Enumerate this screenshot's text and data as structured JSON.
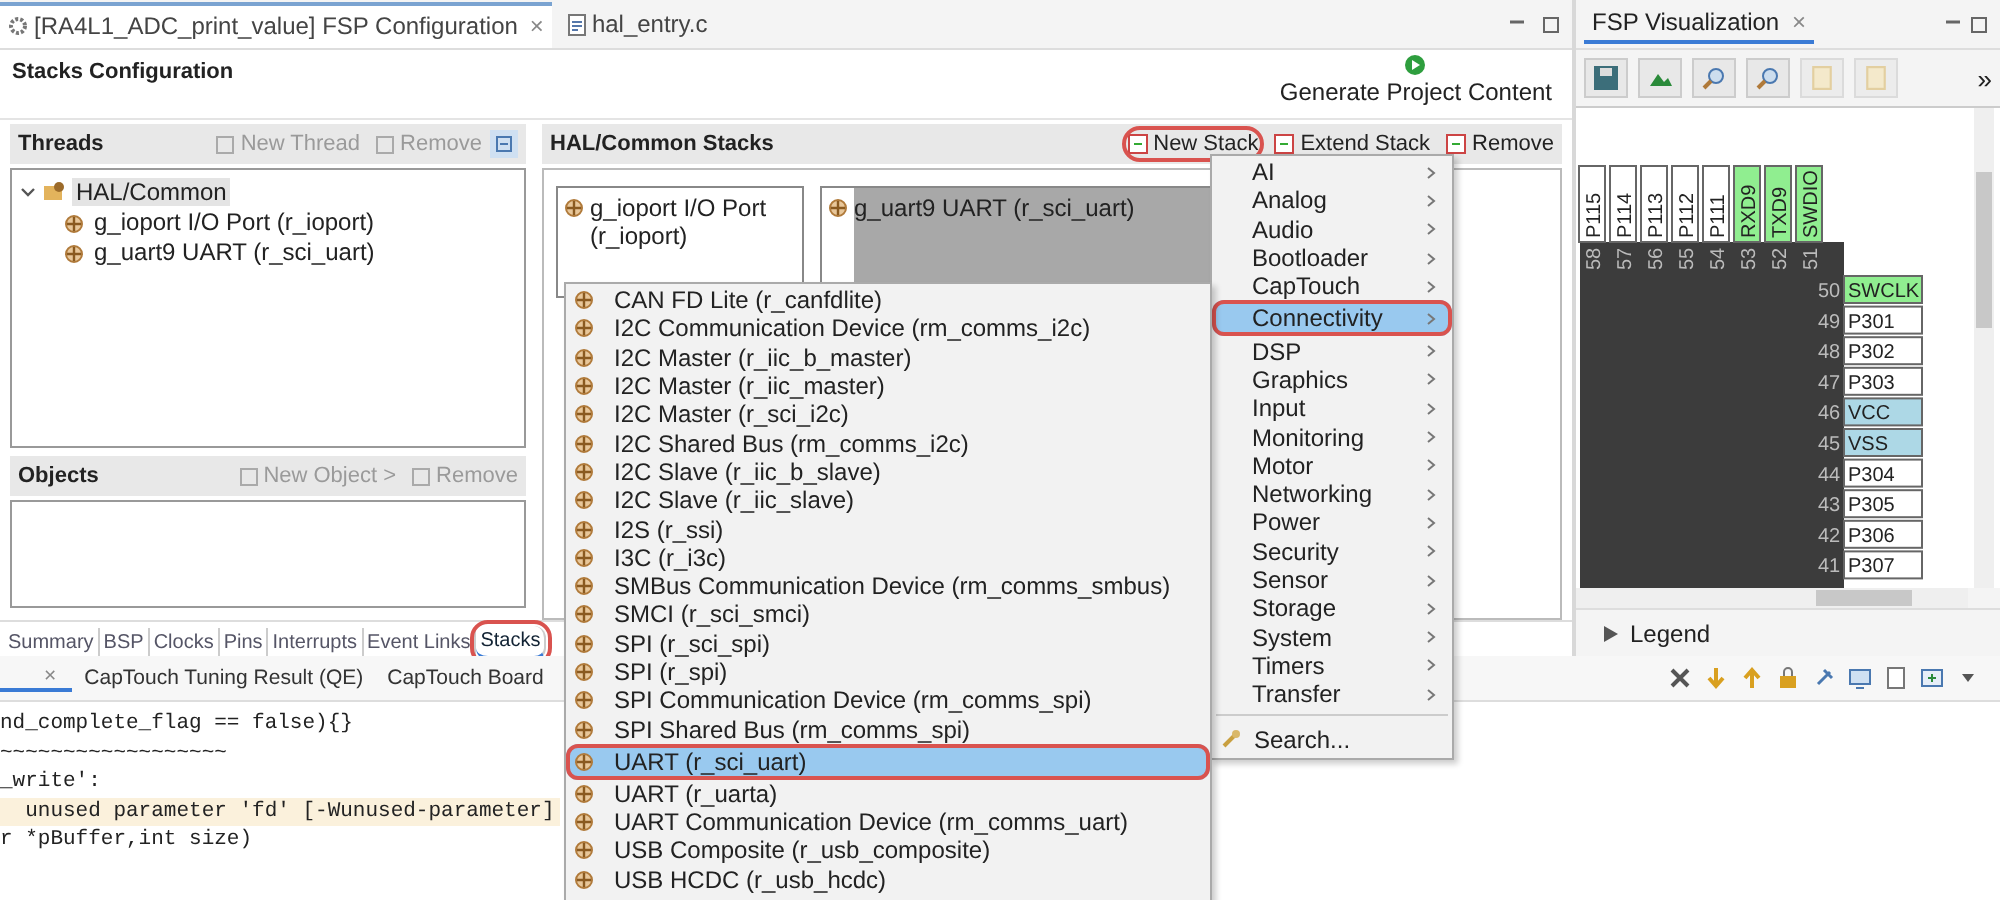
{
  "editor_tabs": [
    {
      "label": "[RA4L1_ADC_print_value] FSP Configuration",
      "selected": true,
      "close": "×"
    },
    {
      "label": "hal_entry.c",
      "selected": false
    }
  ],
  "header": {
    "title": "Stacks Configuration",
    "generate": "Generate Project Content"
  },
  "threads": {
    "title": "Threads",
    "actions": [
      "New Thread",
      "Remove"
    ],
    "tree": [
      {
        "label": "HAL/Common",
        "selected": true,
        "expanded": true,
        "children": [
          {
            "label": "g_ioport I/O Port (r_ioport)",
            "selected": false
          },
          {
            "label": "g_uart9 UART (r_sci_uart)",
            "selected": false
          }
        ]
      }
    ]
  },
  "objects": {
    "title": "Objects",
    "actions": [
      "New Object >",
      "Remove"
    ]
  },
  "stacks": {
    "title": "HAL/Common Stacks",
    "actions": [
      {
        "label": "New Stack",
        "highlighted": true
      },
      {
        "label": "Extend Stack",
        "highlighted": false
      },
      {
        "label": "Remove",
        "highlighted": false
      }
    ],
    "modules": [
      {
        "label": "g_ioport I/O Port (r_ioport)",
        "selected": false
      },
      {
        "label": "g_uart9 UART (r_sci_uart)",
        "selected": true
      }
    ]
  },
  "config_tabs": [
    {
      "label": "Summary",
      "selected": false,
      "highlighted": false
    },
    {
      "label": "BSP",
      "selected": false,
      "highlighted": false
    },
    {
      "label": "Clocks",
      "selected": false,
      "highlighted": false
    },
    {
      "label": "Pins",
      "selected": false,
      "highlighted": false
    },
    {
      "label": "Interrupts",
      "selected": false,
      "highlighted": false
    },
    {
      "label": "Event Links",
      "selected": false,
      "highlighted": false
    },
    {
      "label": "Stacks",
      "selected": true,
      "highlighted": true
    }
  ],
  "console": {
    "close": "×",
    "tabs": [
      "CapTouch Tuning Result (QE)",
      "CapTouch Board"
    ],
    "lines": [
      {
        "text": "nd_complete_flag == false){}",
        "highlighted": false
      },
      {
        "text": "~~~~~~~~~~~~~~~~~~",
        "highlighted": false
      },
      {
        "text": "_write':",
        "highlighted": false
      },
      {
        "text": "  unused parameter 'fd' [-Wunused-parameter]",
        "highlighted": true
      },
      {
        "text": "r *pBuffer,int size)",
        "highlighted": false
      }
    ]
  },
  "visualization": {
    "title": "FSP Visualization",
    "close": "×",
    "more": "»",
    "legend": "Legend",
    "top_pins": [
      {
        "name": "P115",
        "number": "58",
        "color": "#ffffff"
      },
      {
        "name": "P114",
        "number": "57",
        "color": "#ffffff"
      },
      {
        "name": "P113",
        "number": "56",
        "color": "#ffffff"
      },
      {
        "name": "P112",
        "number": "55",
        "color": "#ffffff"
      },
      {
        "name": "P111",
        "number": "54",
        "color": "#ffffff"
      },
      {
        "name": "RXD9",
        "number": "53",
        "color": "#90ee90"
      },
      {
        "name": "TXD9",
        "number": "52",
        "color": "#90ee90"
      },
      {
        "name": "SWDIO",
        "number": "51",
        "color": "#90ee90"
      }
    ],
    "right_pins": [
      {
        "name": "SWCLK",
        "number": "50",
        "color": "#90ee90"
      },
      {
        "name": "P301",
        "number": "49",
        "color": "#ffffff"
      },
      {
        "name": "P302",
        "number": "48",
        "color": "#ffffff"
      },
      {
        "name": "P303",
        "number": "47",
        "color": "#ffffff"
      },
      {
        "name": "VCC",
        "number": "46",
        "color": "#add8e6"
      },
      {
        "name": "VSS",
        "number": "45",
        "color": "#add8e6"
      },
      {
        "name": "P304",
        "number": "44",
        "color": "#ffffff"
      },
      {
        "name": "P305",
        "number": "43",
        "color": "#ffffff"
      },
      {
        "name": "P306",
        "number": "42",
        "color": "#ffffff"
      },
      {
        "name": "P307",
        "number": "41",
        "color": "#ffffff"
      }
    ]
  },
  "category_menu": {
    "search": "Search...",
    "items": [
      {
        "label": "AI",
        "selected": false,
        "highlighted": false
      },
      {
        "label": "Analog",
        "selected": false,
        "highlighted": false
      },
      {
        "label": "Audio",
        "selected": false,
        "highlighted": false
      },
      {
        "label": "Bootloader",
        "selected": false,
        "highlighted": false
      },
      {
        "label": "CapTouch",
        "selected": false,
        "highlighted": false
      },
      {
        "label": "Connectivity",
        "selected": true,
        "highlighted": true
      },
      {
        "label": "DSP",
        "selected": false,
        "highlighted": false
      },
      {
        "label": "Graphics",
        "selected": false,
        "highlighted": false
      },
      {
        "label": "Input",
        "selected": false,
        "highlighted": false
      },
      {
        "label": "Monitoring",
        "selected": false,
        "highlighted": false
      },
      {
        "label": "Motor",
        "selected": false,
        "highlighted": false
      },
      {
        "label": "Networking",
        "selected": false,
        "highlighted": false
      },
      {
        "label": "Power",
        "selected": false,
        "highlighted": false
      },
      {
        "label": "Security",
        "selected": false,
        "highlighted": false
      },
      {
        "label": "Sensor",
        "selected": false,
        "highlighted": false
      },
      {
        "label": "Storage",
        "selected": false,
        "highlighted": false
      },
      {
        "label": "System",
        "selected": false,
        "highlighted": false
      },
      {
        "label": "Timers",
        "selected": false,
        "highlighted": false
      },
      {
        "label": "Transfer",
        "selected": false,
        "highlighted": false
      }
    ]
  },
  "module_menu": {
    "items": [
      {
        "label": "CAN FD Lite (r_canfdlite)",
        "selected": false,
        "highlighted": false
      },
      {
        "label": "I2C Communication Device (rm_comms_i2c)",
        "selected": false,
        "highlighted": false
      },
      {
        "label": "I2C Master (r_iic_b_master)",
        "selected": false,
        "highlighted": false
      },
      {
        "label": "I2C Master (r_iic_master)",
        "selected": false,
        "highlighted": false
      },
      {
        "label": "I2C Master (r_sci_i2c)",
        "selected": false,
        "highlighted": false
      },
      {
        "label": "I2C Shared Bus (rm_comms_i2c)",
        "selected": false,
        "highlighted": false
      },
      {
        "label": "I2C Slave (r_iic_b_slave)",
        "selected": false,
        "highlighted": false
      },
      {
        "label": "I2C Slave (r_iic_slave)",
        "selected": false,
        "highlighted": false
      },
      {
        "label": "I2S (r_ssi)",
        "selected": false,
        "highlighted": false
      },
      {
        "label": "I3C (r_i3c)",
        "selected": false,
        "highlighted": false
      },
      {
        "label": "SMBus Communication Device (rm_comms_smbus)",
        "selected": false,
        "highlighted": false
      },
      {
        "label": "SMCI (r_sci_smci)",
        "selected": false,
        "highlighted": false
      },
      {
        "label": "SPI (r_sci_spi)",
        "selected": false,
        "highlighted": false
      },
      {
        "label": "SPI (r_spi)",
        "selected": false,
        "highlighted": false
      },
      {
        "label": "SPI Communication Device (rm_comms_spi)",
        "selected": false,
        "highlighted": false
      },
      {
        "label": "SPI Shared Bus (rm_comms_spi)",
        "selected": false,
        "highlighted": false
      },
      {
        "label": "UART (r_sci_uart)",
        "selected": true,
        "highlighted": true
      },
      {
        "label": "UART (r_uarta)",
        "selected": false,
        "highlighted": false
      },
      {
        "label": "UART Communication Device (rm_comms_uart)",
        "selected": false,
        "highlighted": false
      },
      {
        "label": "USB Composite (r_usb_composite)",
        "selected": false,
        "highlighted": false
      },
      {
        "label": "USB HCDC (r_usb_hcdc)",
        "selected": false,
        "highlighted": false
      }
    ]
  }
}
